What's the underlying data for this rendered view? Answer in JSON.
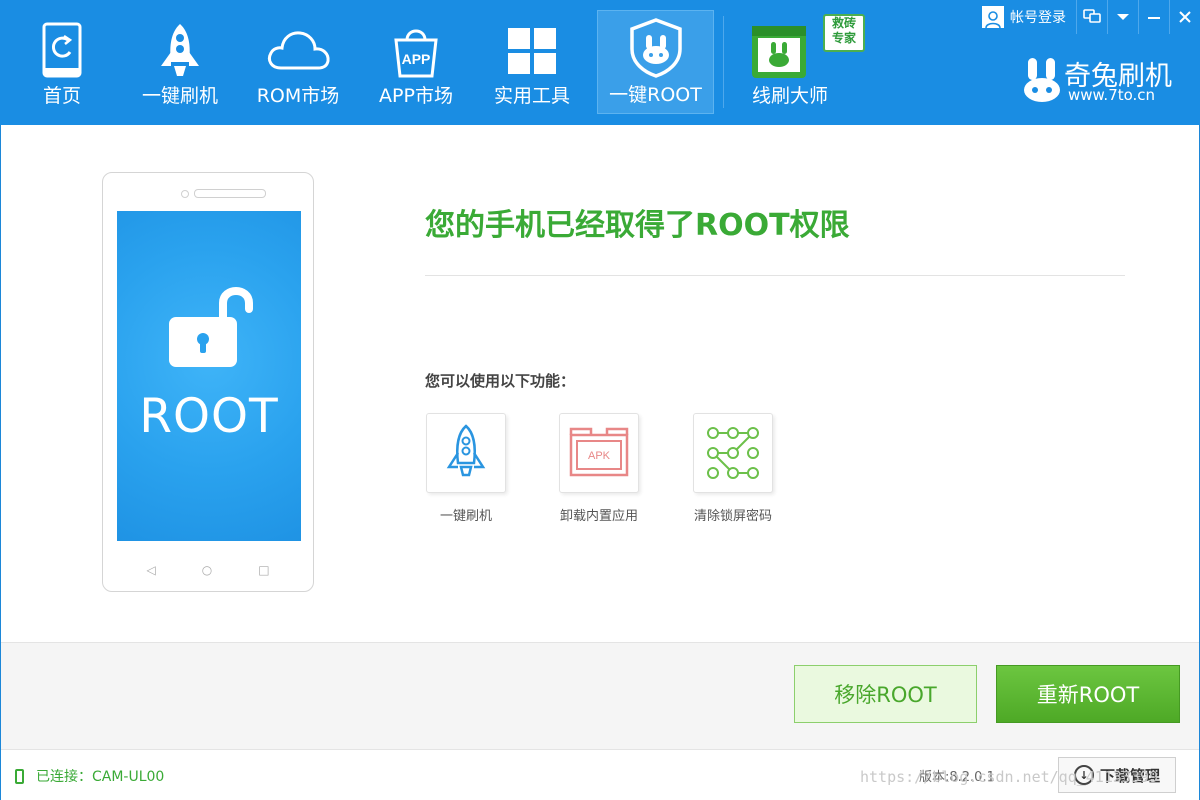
{
  "nav": {
    "items": [
      {
        "label": "首页",
        "icon": "home-icon"
      },
      {
        "label": "一键刷机",
        "icon": "rocket-icon"
      },
      {
        "label": "ROM市场",
        "icon": "cloud-icon"
      },
      {
        "label": "APP市场",
        "icon": "app-bag-icon",
        "icon_text": "APP"
      },
      {
        "label": "实用工具",
        "icon": "windows-grid-icon"
      },
      {
        "label": "一键ROOT",
        "icon": "shield-rabbit-icon"
      },
      {
        "label": "线刷大师",
        "icon": "rabbit-calendar-icon",
        "badge": "救砖\n专家"
      }
    ],
    "active": "一键ROOT"
  },
  "header": {
    "login_label": "帐号登录",
    "brand_name": "奇兔刷机",
    "brand_url": "www.7to.cn"
  },
  "phone": {
    "screen_text": "ROOT"
  },
  "main": {
    "headline": "您的手机已经取得了ROOT权限",
    "features_title": "您可以使用以下功能：",
    "features": [
      {
        "label": "一键刷机",
        "icon": "rocket-icon"
      },
      {
        "label": "卸载内置应用",
        "icon": "apk-box-icon",
        "icon_text": "APK"
      },
      {
        "label": "清除锁屏密码",
        "icon": "pattern-lock-icon"
      }
    ]
  },
  "actions": {
    "remove_root_label": "移除ROOT",
    "reroot_label": "重新ROOT"
  },
  "status": {
    "connection": "已连接：CAM-UL00",
    "version": "版本:8.2.0.1",
    "download_manager": "下载管理",
    "watermark": "https://blog.csdn.net/qq_41133399"
  },
  "colors": {
    "nav_blue": "#1a8de3",
    "success_green": "#3aaa36",
    "phone_screen": "#2aa2ee"
  }
}
